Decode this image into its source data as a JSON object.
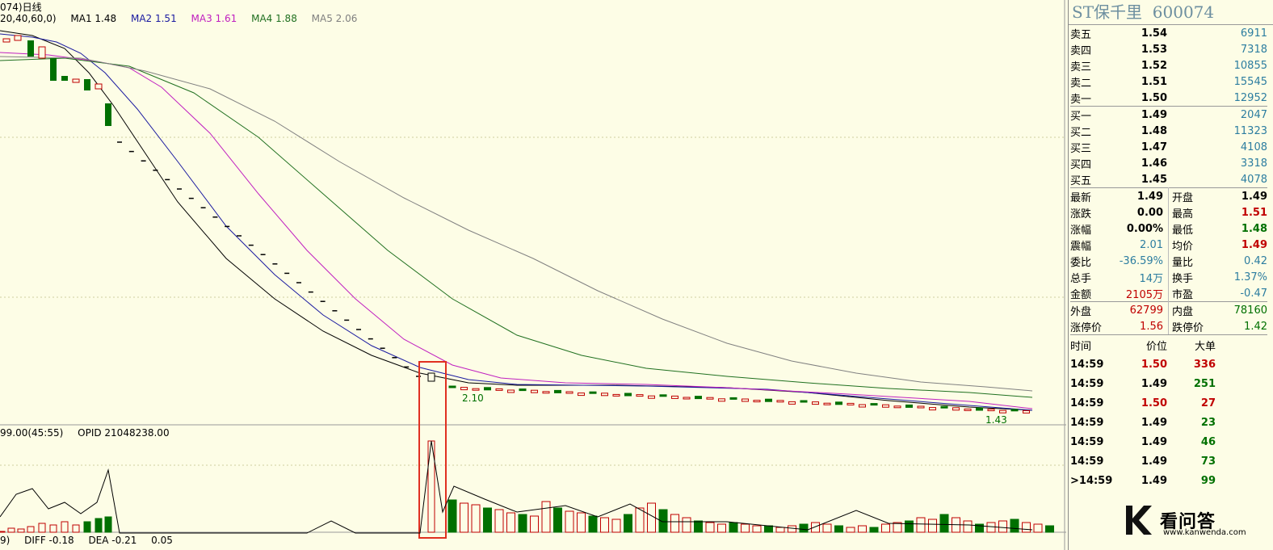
{
  "header": {
    "title_frag": "074)日线",
    "ma": [
      {
        "label": "MA1 1.48",
        "color": "#000000"
      },
      {
        "label": "MA2 1.51",
        "color": "#1a1aa0"
      },
      {
        "label": "MA3 1.61",
        "color": "#c020c0"
      },
      {
        "label": "MA4 1.88",
        "color": "#207020"
      },
      {
        "label": "MA5 2.06",
        "color": "#808080"
      }
    ],
    "ma_params": "20,40,60,0)"
  },
  "chart_labels": {
    "low_mark": "2.10",
    "end_mark": "1.43"
  },
  "indicator": {
    "vol_label": "99.00(45:55)",
    "opid_label": "OPID 21048238.00",
    "macd_prefix": "9)",
    "diff": "DIFF -0.18",
    "dea": "DEA -0.21",
    "macd_val": "0.05"
  },
  "colors": {
    "up": "#c00000",
    "down": "#007000",
    "highlight": "#e03020",
    "bg": "#fdfde6"
  },
  "chart_data": {
    "type": "line",
    "series": [
      {
        "name": "MA1",
        "values": [
          1.48
        ]
      },
      {
        "name": "MA2",
        "values": [
          1.51
        ]
      },
      {
        "name": "MA3",
        "values": [
          1.61
        ]
      },
      {
        "name": "MA4",
        "values": [
          1.88
        ]
      },
      {
        "name": "MA5",
        "values": [
          2.06
        ]
      }
    ]
  },
  "stock": {
    "name": "ST保千里",
    "code": "600074"
  },
  "sell": [
    {
      "label": "卖五",
      "price": "1.54",
      "vol": "6911"
    },
    {
      "label": "卖四",
      "price": "1.53",
      "vol": "7318"
    },
    {
      "label": "卖三",
      "price": "1.52",
      "vol": "10855"
    },
    {
      "label": "卖二",
      "price": "1.51",
      "vol": "15545"
    },
    {
      "label": "卖一",
      "price": "1.50",
      "vol": "12952"
    }
  ],
  "buy": [
    {
      "label": "买一",
      "price": "1.49",
      "vol": "2047"
    },
    {
      "label": "买二",
      "price": "1.48",
      "vol": "11323"
    },
    {
      "label": "买三",
      "price": "1.47",
      "vol": "4108"
    },
    {
      "label": "买四",
      "price": "1.46",
      "vol": "3318"
    },
    {
      "label": "买五",
      "price": "1.45",
      "vol": "4078"
    }
  ],
  "stats": [
    {
      "l1": "最新",
      "v1": "1.49",
      "c1": "bold",
      "l2": "开盘",
      "v2": "1.49",
      "c2": "bold"
    },
    {
      "l1": "涨跌",
      "v1": "0.00",
      "c1": "bold",
      "l2": "最高",
      "v2": "1.51",
      "c2": "red bold"
    },
    {
      "l1": "涨幅",
      "v1": "0.00%",
      "c1": "bold",
      "l2": "最低",
      "v2": "1.48",
      "c2": "green bold"
    },
    {
      "l1": "震幅",
      "v1": "2.01",
      "c1": "blue",
      "l2": "均价",
      "v2": "1.49",
      "c2": "red bold"
    },
    {
      "l1": "委比",
      "v1": "-36.59%",
      "c1": "blue",
      "l2": "量比",
      "v2": "0.42",
      "c2": "blue"
    },
    {
      "l1": "总手",
      "v1": "14万",
      "c1": "blue",
      "l2": "换手",
      "v2": "1.37%",
      "c2": "blue"
    },
    {
      "l1": "金额",
      "v1": "2105万",
      "c1": "red",
      "l2": "市盈",
      "v2": "-0.47",
      "c2": "blue"
    }
  ],
  "stats2": [
    {
      "l1": "外盘",
      "v1": "62799",
      "c1": "red",
      "l2": "内盘",
      "v2": "78160",
      "c2": "green"
    },
    {
      "l1": "涨停价",
      "v1": "1.56",
      "c1": "red",
      "l2": "跌停价",
      "v2": "1.42",
      "c2": "green"
    }
  ],
  "ticks_header": {
    "time": "时间",
    "price": "价位",
    "big": "大单"
  },
  "ticks": [
    {
      "time": "14:59",
      "price": "1.50",
      "pc": "red",
      "vol": "336",
      "vc": "red"
    },
    {
      "time": "14:59",
      "price": "1.49",
      "pc": "",
      "vol": "251",
      "vc": "green"
    },
    {
      "time": "14:59",
      "price": "1.50",
      "pc": "red",
      "vol": "27",
      "vc": "red"
    },
    {
      "time": "14:59",
      "price": "1.49",
      "pc": "",
      "vol": "23",
      "vc": "green"
    },
    {
      "time": "14:59",
      "price": "1.49",
      "pc": "",
      "vol": "46",
      "vc": "green"
    },
    {
      "time": "14:59",
      "price": "1.49",
      "pc": "",
      "vol": "73",
      "vc": "green"
    },
    {
      "time": ">14:59",
      "price": "1.49",
      "pc": "",
      "vol": "99",
      "vc": "green"
    }
  ],
  "watermark": {
    "brand": "看问答",
    "url": "www.kanwenda.com"
  }
}
